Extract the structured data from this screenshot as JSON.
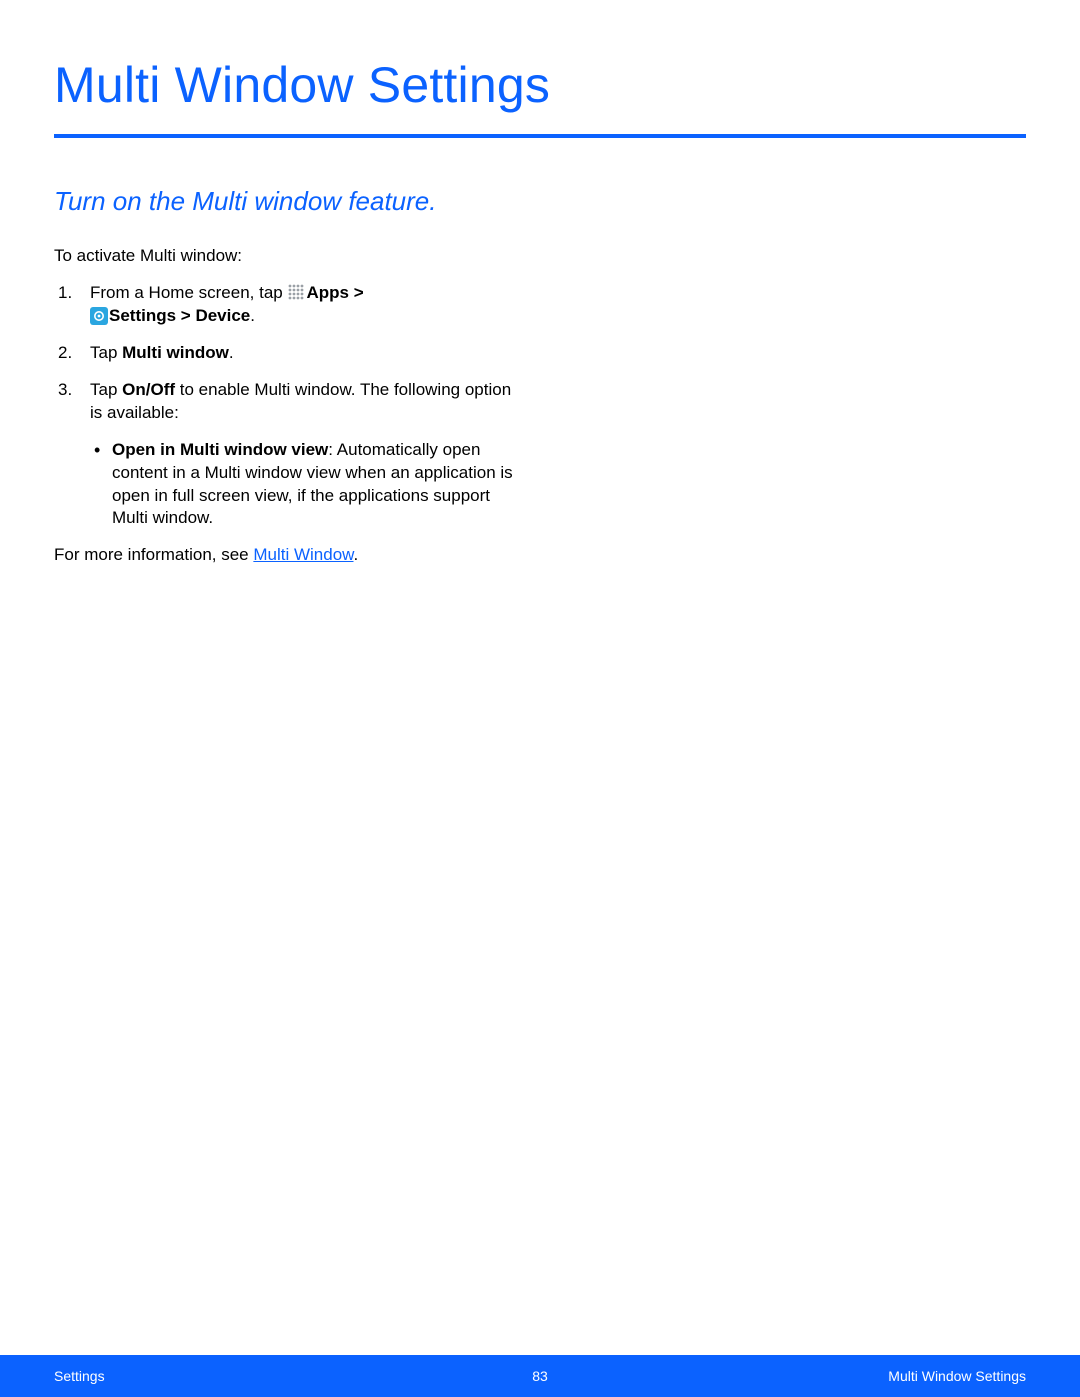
{
  "page_title": "Multi Window Settings",
  "subtitle": "Turn on the Multi window feature.",
  "intro": "To activate Multi window:",
  "steps": {
    "s1": {
      "num": "1.",
      "pre": "From a Home screen, tap ",
      "apps_label": "Apps",
      "gt1": " > ",
      "settings_label": "Settings",
      "gt2": "  > ",
      "device_label": "Device",
      "period": "."
    },
    "s2": {
      "num": "2.",
      "pre": "Tap ",
      "bold": "Multi window",
      "post": "."
    },
    "s3": {
      "num": "3.",
      "pre": "Tap ",
      "bold": "On/Off",
      "post": " to enable Multi window. The following option is available:"
    }
  },
  "bullet": {
    "bold": "Open in Multi window view",
    "rest": ": Automatically open content in a Multi window view when an application is open in full screen view, if the applications support Multi window."
  },
  "moreinfo": {
    "pre": "For more information, see ",
    "link": "Multi Window",
    "post": "."
  },
  "footer": {
    "left": "Settings",
    "center": "83",
    "right": "Multi Window Settings"
  }
}
